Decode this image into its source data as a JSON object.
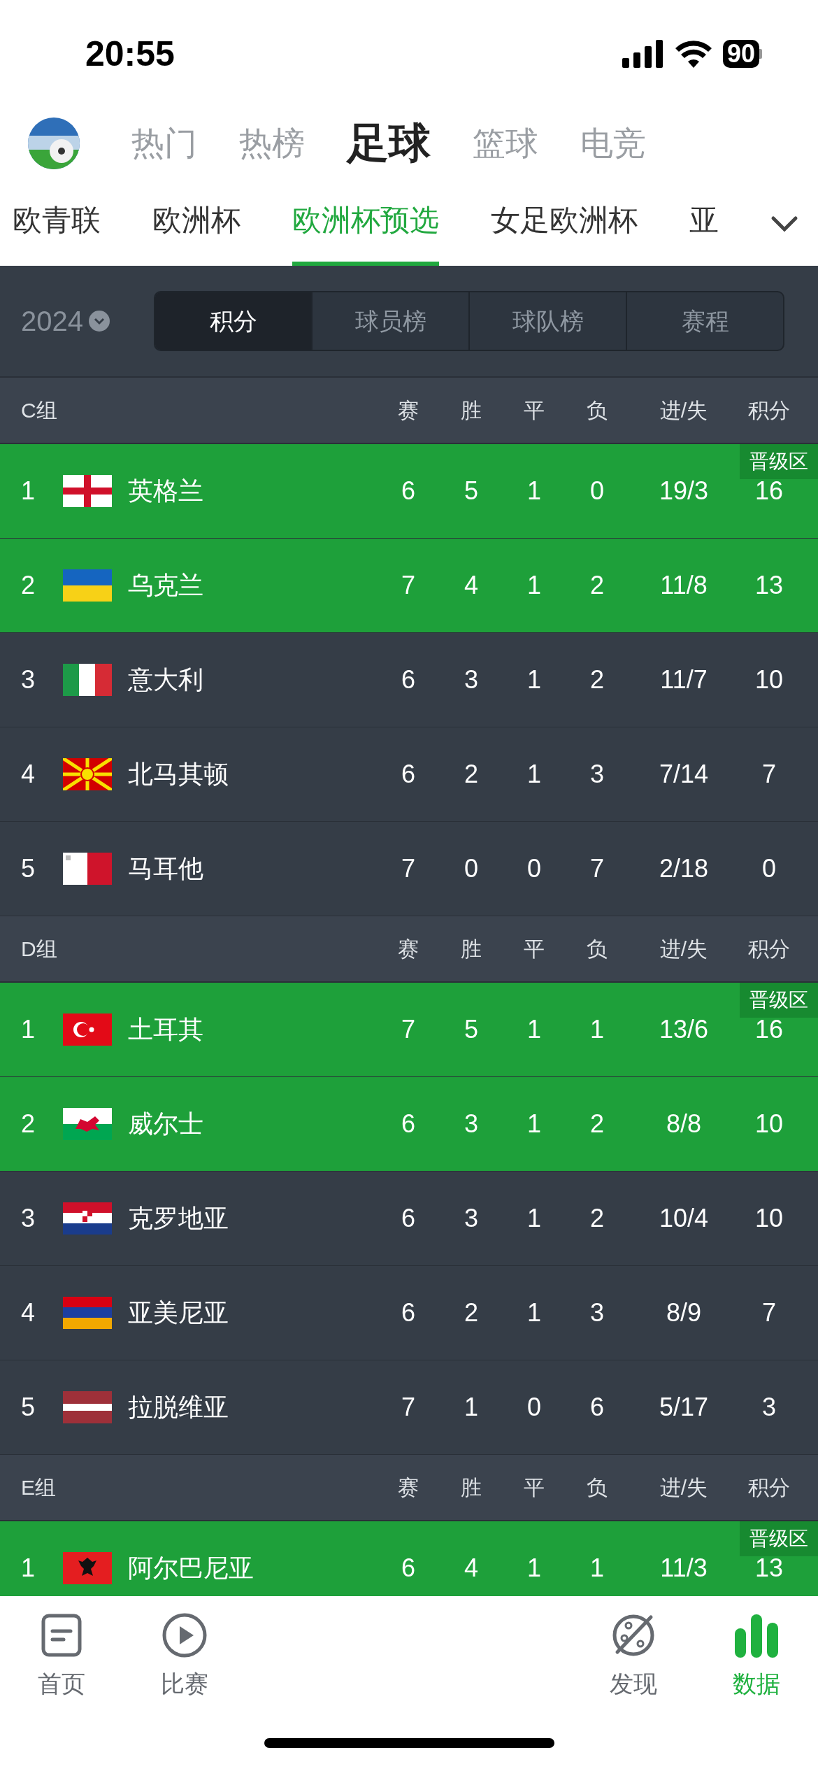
{
  "status_bar": {
    "time": "20:55",
    "battery": "90"
  },
  "top_tabs": [
    {
      "label": "热门",
      "selected": false
    },
    {
      "label": "热榜",
      "selected": false
    },
    {
      "label": "足球",
      "selected": true
    },
    {
      "label": "篮球",
      "selected": false
    },
    {
      "label": "电竞",
      "selected": false
    }
  ],
  "league_tabs": [
    {
      "label": "欧青联",
      "selected": false
    },
    {
      "label": "欧洲杯",
      "selected": false
    },
    {
      "label": "欧洲杯预选",
      "selected": true
    },
    {
      "label": "女足欧洲杯",
      "selected": false
    },
    {
      "label": "亚",
      "selected": false
    }
  ],
  "season": {
    "year": "2024"
  },
  "segments": [
    {
      "label": "积分",
      "selected": true
    },
    {
      "label": "球员榜",
      "selected": false
    },
    {
      "label": "球队榜",
      "selected": false
    },
    {
      "label": "赛程",
      "selected": false
    }
  ],
  "groups": [
    {
      "name": "C组",
      "columns": [
        "赛",
        "胜",
        "平",
        "负",
        "进/失",
        "积分"
      ],
      "rows": [
        {
          "rank": "1",
          "team": "英格兰",
          "played": "6",
          "won": "5",
          "drawn": "1",
          "lost": "0",
          "goals": "19/3",
          "points": "16",
          "qualified": true,
          "badge": "晋级区"
        },
        {
          "rank": "2",
          "team": "乌克兰",
          "played": "7",
          "won": "4",
          "drawn": "1",
          "lost": "2",
          "goals": "11/8",
          "points": "13",
          "qualified": true
        },
        {
          "rank": "3",
          "team": "意大利",
          "played": "6",
          "won": "3",
          "drawn": "1",
          "lost": "2",
          "goals": "11/7",
          "points": "10",
          "qualified": false
        },
        {
          "rank": "4",
          "team": "北马其顿",
          "played": "6",
          "won": "2",
          "drawn": "1",
          "lost": "3",
          "goals": "7/14",
          "points": "7",
          "qualified": false
        },
        {
          "rank": "5",
          "team": "马耳他",
          "played": "7",
          "won": "0",
          "drawn": "0",
          "lost": "7",
          "goals": "2/18",
          "points": "0",
          "qualified": false
        }
      ]
    },
    {
      "name": "D组",
      "columns": [
        "赛",
        "胜",
        "平",
        "负",
        "进/失",
        "积分"
      ],
      "rows": [
        {
          "rank": "1",
          "team": "土耳其",
          "played": "7",
          "won": "5",
          "drawn": "1",
          "lost": "1",
          "goals": "13/6",
          "points": "16",
          "qualified": true,
          "badge": "晋级区"
        },
        {
          "rank": "2",
          "team": "威尔士",
          "played": "6",
          "won": "3",
          "drawn": "1",
          "lost": "2",
          "goals": "8/8",
          "points": "10",
          "qualified": true
        },
        {
          "rank": "3",
          "team": "克罗地亚",
          "played": "6",
          "won": "3",
          "drawn": "1",
          "lost": "2",
          "goals": "10/4",
          "points": "10",
          "qualified": false
        },
        {
          "rank": "4",
          "team": "亚美尼亚",
          "played": "6",
          "won": "2",
          "drawn": "1",
          "lost": "3",
          "goals": "8/9",
          "points": "7",
          "qualified": false
        },
        {
          "rank": "5",
          "team": "拉脱维亚",
          "played": "7",
          "won": "1",
          "drawn": "0",
          "lost": "6",
          "goals": "5/17",
          "points": "3",
          "qualified": false
        }
      ]
    },
    {
      "name": "E组",
      "columns": [
        "赛",
        "胜",
        "平",
        "负",
        "进/失",
        "积分"
      ],
      "rows": [
        {
          "rank": "1",
          "team": "阿尔巴尼亚",
          "played": "6",
          "won": "4",
          "drawn": "1",
          "lost": "1",
          "goals": "11/3",
          "points": "13",
          "qualified": true,
          "badge": "晋级区"
        }
      ]
    }
  ],
  "bottom_nav": [
    {
      "label": "首页",
      "selected": false
    },
    {
      "label": "比赛",
      "selected": false
    },
    {
      "label": "发现",
      "selected": false
    },
    {
      "label": "数据",
      "selected": true
    }
  ]
}
